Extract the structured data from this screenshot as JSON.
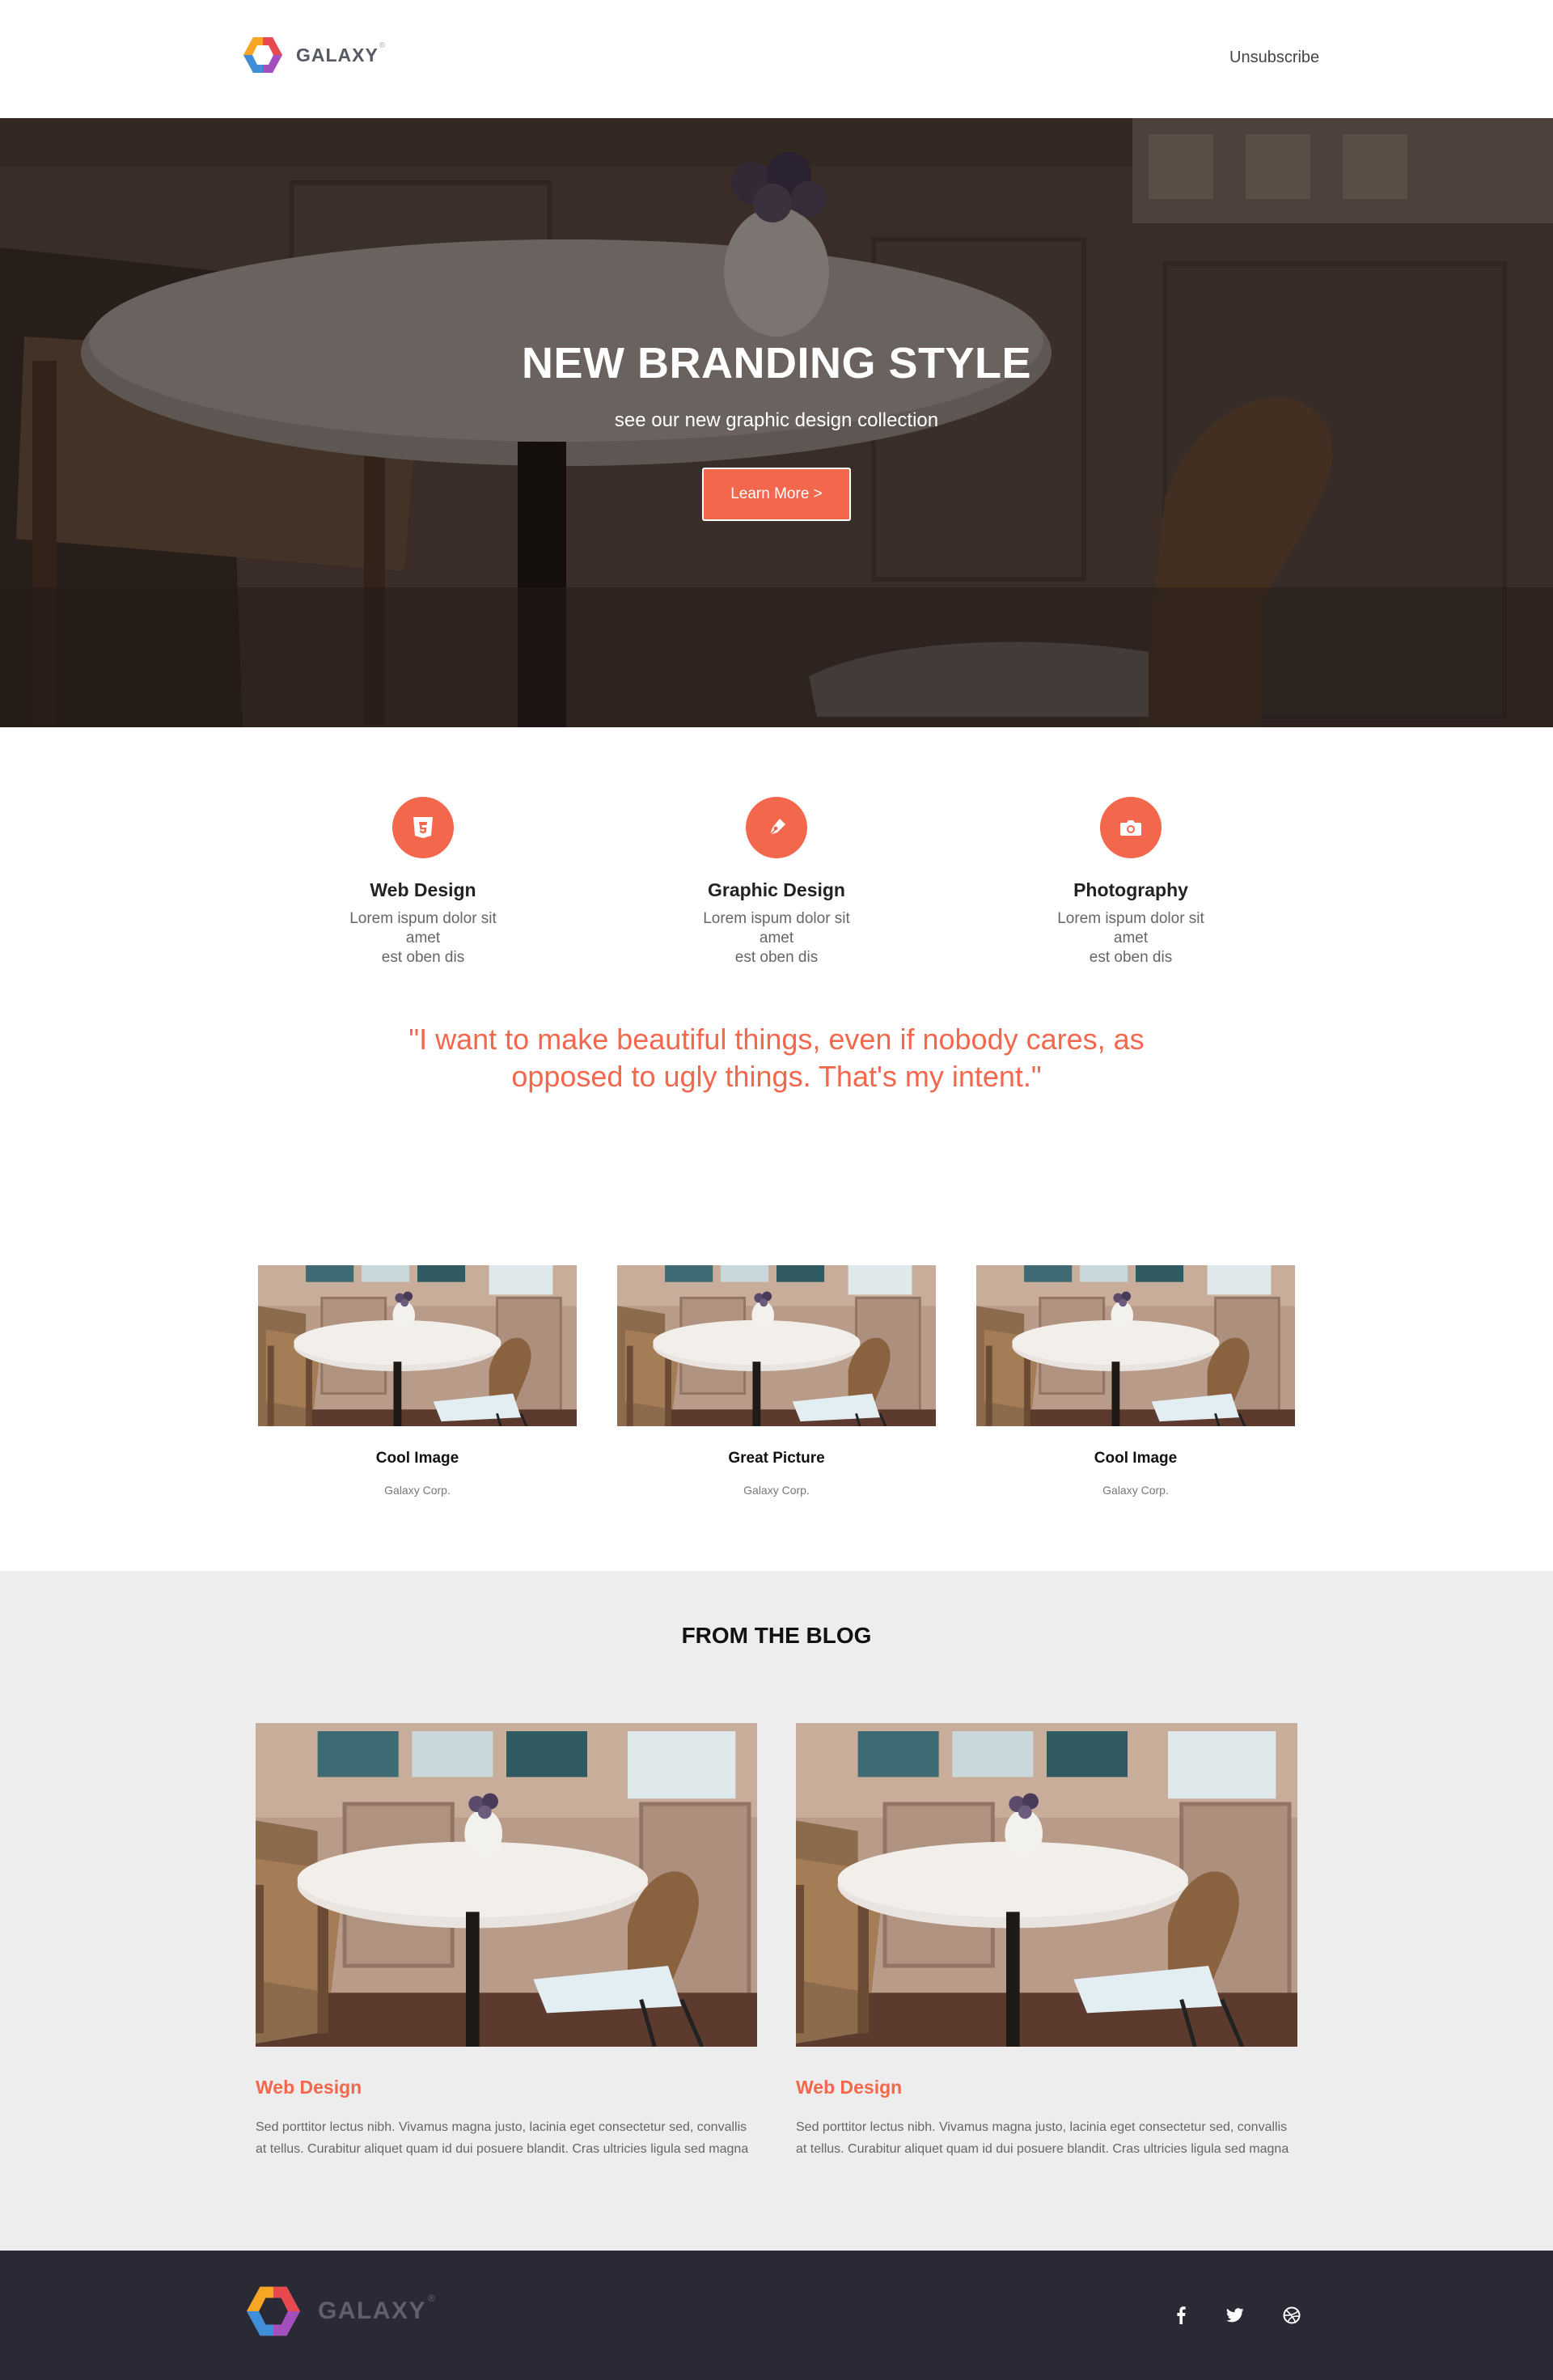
{
  "header": {
    "brand": "GALAXY",
    "brand_mark": "®",
    "unsubscribe": "Unsubscribe"
  },
  "hero": {
    "title": "NEW BRANDING STYLE",
    "subtitle": "see our new graphic design collection",
    "button": "Learn More >"
  },
  "services": [
    {
      "icon": "html5-icon",
      "title": "Web Design",
      "line1": "Lorem ispum dolor sit amet",
      "line2": "est oben dis"
    },
    {
      "icon": "pen-icon",
      "title": "Graphic Design",
      "line1": "Lorem ispum dolor sit amet",
      "line2": "est oben dis"
    },
    {
      "icon": "camera-icon",
      "title": "Photography",
      "line1": "Lorem ispum dolor sit amet",
      "line2": "est oben dis"
    }
  ],
  "quote": "\"I want to make beautiful things, even if nobody cares, as opposed to ugly things. That's my intent.\"",
  "gallery": [
    {
      "title": "Cool Image",
      "caption": "Galaxy Corp."
    },
    {
      "title": "Great Picture",
      "caption": "Galaxy Corp."
    },
    {
      "title": "Cool Image",
      "caption": "Galaxy Corp."
    }
  ],
  "blog": {
    "heading": "FROM THE BLOG",
    "posts": [
      {
        "title": "Web Design",
        "text": "Sed porttitor lectus nibh. Vivamus magna justo, lacinia eget consectetur sed, convallis at tellus. Curabitur aliquet quam id dui posuere blandit. Cras ultricies ligula sed magna"
      },
      {
        "title": "Web Design",
        "text": "Sed porttitor lectus nibh. Vivamus magna justo, lacinia eget consectetur sed, convallis at tellus. Curabitur aliquet quam id dui posuere blandit. Cras ultricies ligula sed magna"
      }
    ]
  },
  "footer": {
    "brand": "GALAXY",
    "brand_mark": "®",
    "social": [
      "facebook-icon",
      "twitter-icon",
      "dribbble-icon"
    ]
  },
  "colors": {
    "accent": "#f3674d",
    "footer_bg": "#292a36",
    "blog_bg": "#ededed"
  }
}
